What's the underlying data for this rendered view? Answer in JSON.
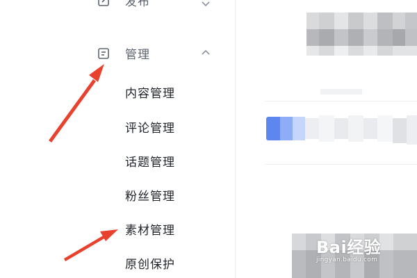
{
  "sidebar": {
    "publish": {
      "label": "发布",
      "icon": "edit-icon",
      "chevron": "chevron-down-icon"
    },
    "manage": {
      "label": "管理",
      "icon": "document-icon",
      "chevron": "chevron-up-icon"
    },
    "items": [
      {
        "label": "内容管理"
      },
      {
        "label": "评论管理"
      },
      {
        "label": "话题管理"
      },
      {
        "label": "粉丝管理"
      },
      {
        "label": "素材管理"
      },
      {
        "label": "原创保护"
      }
    ]
  },
  "annotation": {
    "arrow_color": "#e8412e"
  },
  "watermark": {
    "brand": "Bai经验",
    "url": "jingyan.baidu.com"
  }
}
